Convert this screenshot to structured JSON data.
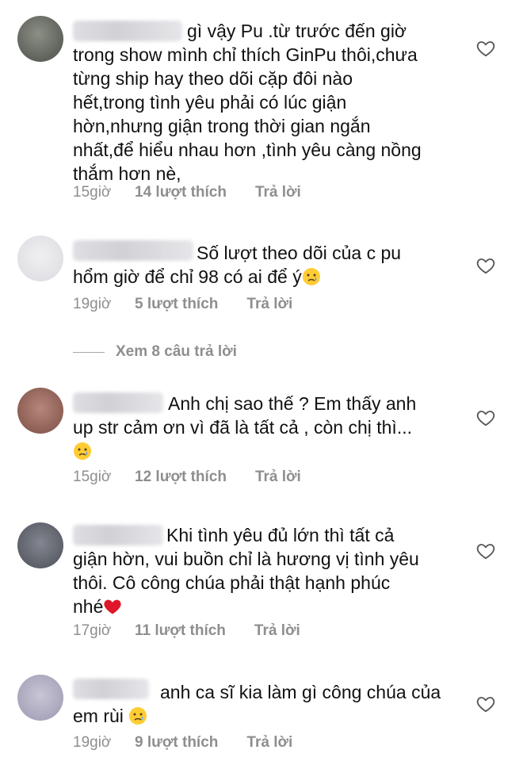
{
  "comments": [
    {
      "text": "gì vậy Pu .từ trước đến giờ\ntrong show mình chỉ thích GinPu thôi,chưa\ntừng ship hay theo dõi cặp đôi nào\nhết,trong tình yêu phải có lúc giận\nhờn,nhưng giận trong thời gian ngắn\nnhất,để hiểu nhau hơn ,tình yêu càng nồng\nthắm hơn nè,",
      "time": "15giờ",
      "likes": "14 lượt thích",
      "reply": "Trả lời"
    },
    {
      "text": "Số lượt theo dõi của c pu\nhổm giờ để chỉ 98 có ai để ý",
      "time": "19giờ",
      "likes": "5 lượt thích",
      "reply": "Trả lời",
      "emoji": "crying-face"
    },
    {
      "text": "Anh chị sao thế ? Em thấy anh\nup str cảm ơn vì đã là tất cả , còn chị thì...\n",
      "time": "15giờ",
      "likes": "12 lượt thích",
      "reply": "Trả lời",
      "emoji": "crying-face"
    },
    {
      "text": "Khi tình yêu đủ lớn thì tất cả\ngiận hờn, vui buồn chỉ là hương vị tình yêu\nthôi. Cô công chúa phải thật hạnh phúc\nnhé",
      "time": "17giờ",
      "likes": "11 lượt thích",
      "reply": "Trả lời",
      "emoji": "red-heart"
    },
    {
      "text": "anh ca sĩ kia làm gì công chúa của\nem rùi ",
      "time": "19giờ",
      "likes": "9 lượt thích",
      "reply": "Trả lời",
      "emoji": "crying-face"
    }
  ],
  "view_replies": "Xem 8 câu trả lời",
  "icons": {
    "like": "heart-outline-icon"
  },
  "colors": {
    "meta": "#8e8e8e",
    "text": "#111111",
    "heart_emoji": "#e0162b"
  }
}
